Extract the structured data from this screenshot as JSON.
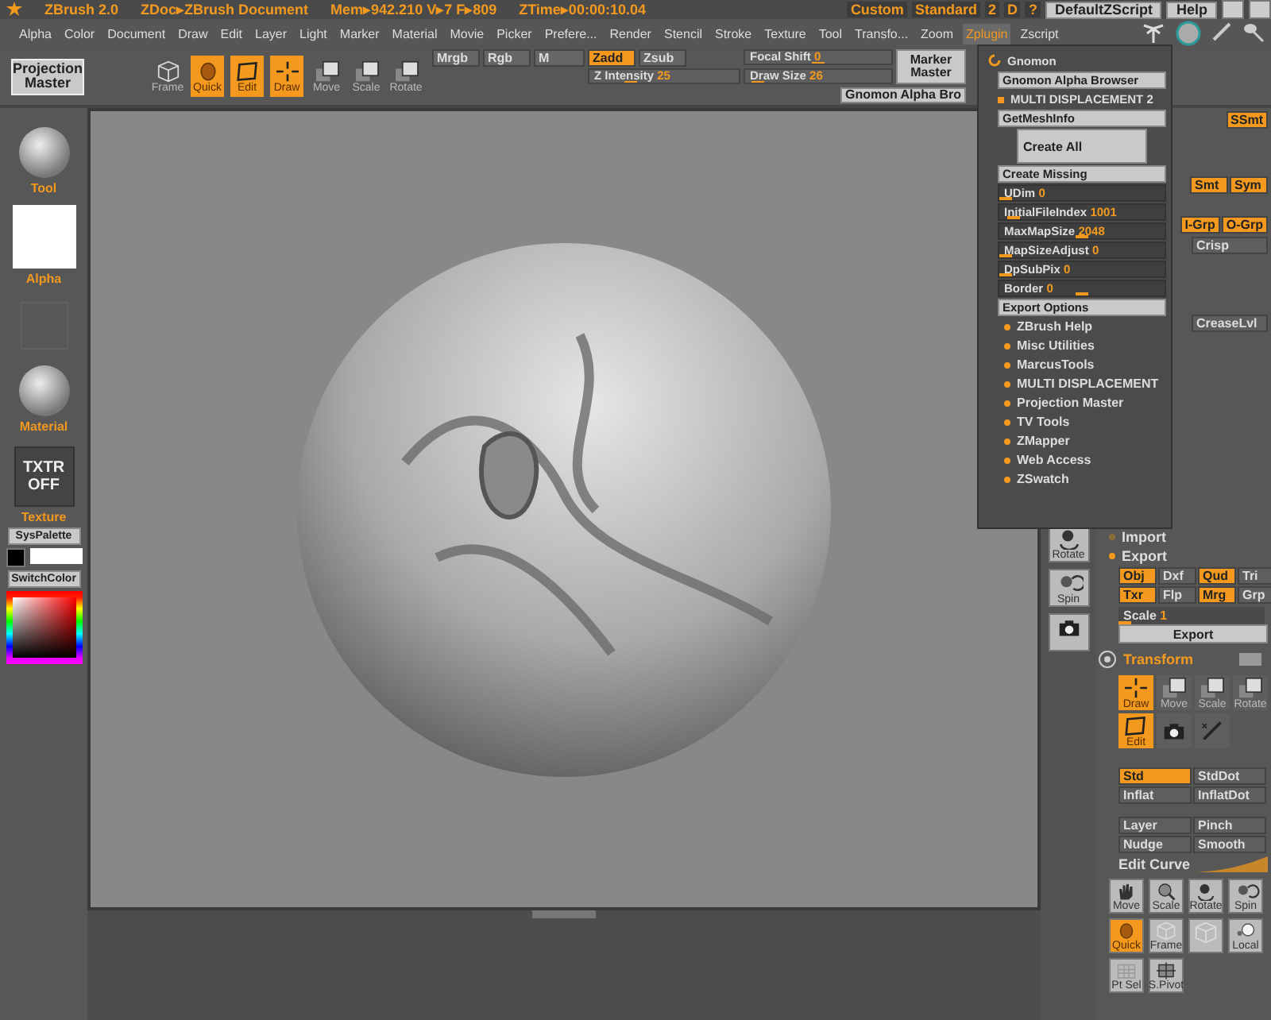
{
  "title_bar": {
    "app": "ZBrush 2.0",
    "doc": "ZDoc▸ZBrush Document",
    "stats": "Mem▸942.210 V▸7 F▸809",
    "time": "ZTime▸00:00:10.04",
    "layout": [
      "Custom",
      "Standard",
      "2",
      "D",
      "?"
    ],
    "buttons": [
      "DefaultZScript",
      "Help"
    ]
  },
  "menu": [
    {
      "label": "Alpha",
      "selected": false
    },
    {
      "label": "Color",
      "selected": false
    },
    {
      "label": "Document",
      "selected": false
    },
    {
      "label": "Draw",
      "selected": false
    },
    {
      "label": "Edit",
      "selected": false
    },
    {
      "label": "Layer",
      "selected": false
    },
    {
      "label": "Light",
      "selected": false
    },
    {
      "label": "Marker",
      "selected": false
    },
    {
      "label": "Material",
      "selected": false
    },
    {
      "label": "Movie",
      "selected": false
    },
    {
      "label": "Picker",
      "selected": false
    },
    {
      "label": "Prefere...",
      "selected": false
    },
    {
      "label": "Render",
      "selected": false
    },
    {
      "label": "Stencil",
      "selected": false
    },
    {
      "label": "Stroke",
      "selected": false
    },
    {
      "label": "Texture",
      "selected": false
    },
    {
      "label": "Tool",
      "selected": false
    },
    {
      "label": "Transfo...",
      "selected": false
    },
    {
      "label": "Zoom",
      "selected": false
    },
    {
      "label": "Zplugin",
      "selected": true
    },
    {
      "label": "Zscript",
      "selected": false
    }
  ],
  "toolbar": {
    "projection_master": "Projection Master",
    "tools": [
      {
        "label": "Frame",
        "kind": "cube",
        "on": false
      },
      {
        "label": "Quick",
        "kind": "quick",
        "on": true
      },
      {
        "label": "Edit",
        "kind": "edit",
        "on": true
      },
      {
        "label": "Draw",
        "kind": "draw",
        "on": true
      },
      {
        "label": "Move",
        "kind": "move",
        "on": false
      },
      {
        "label": "Scale",
        "kind": "scale",
        "on": false
      },
      {
        "label": "Rotate",
        "kind": "rotate",
        "on": false
      }
    ],
    "channels": [
      {
        "label": "Mrgb",
        "on": false
      },
      {
        "label": "Rgb",
        "on": false
      },
      {
        "label": "M",
        "on": false
      },
      {
        "label": "Zadd",
        "on": true
      },
      {
        "label": "Zsub",
        "on": false
      }
    ],
    "sliders": [
      {
        "label": "Focal Shift",
        "value": "0",
        "level": 0.5
      },
      {
        "label": "Z Intensity",
        "value": "25",
        "level": 0.25
      },
      {
        "label": "Draw Size",
        "value": "26",
        "level": 0.05
      }
    ],
    "marker_master": "Marker Master",
    "gnomon_button": "Gnomon Alpha Bro"
  },
  "left_panel": {
    "tool": "Tool",
    "alpha": "Alpha",
    "material": "Material",
    "texture_box": "TXTR OFF",
    "texture": "Texture",
    "palette": "SysPalette",
    "switch_color": "SwitchColor"
  },
  "plugin_menu": {
    "title": "Gnomon",
    "items": [
      {
        "kind": "button",
        "label": "Gnomon Alpha Browser"
      },
      {
        "kind": "header",
        "label": "MULTI DISPLACEMENT 2"
      },
      {
        "kind": "button",
        "label": "GetMeshInfo"
      },
      {
        "kind": "big",
        "label": "Create All"
      },
      {
        "kind": "button",
        "label": "Create Missing"
      },
      {
        "kind": "slider",
        "label": "UDim",
        "value": "0",
        "level": 0
      },
      {
        "kind": "slider",
        "label": "InitialFileIndex",
        "value": "1001",
        "level": 0.05
      },
      {
        "kind": "slider",
        "label": "MaxMapSize",
        "value": "2048",
        "level": 0.5
      },
      {
        "kind": "slider",
        "label": "MapSizeAdjust",
        "value": "0",
        "level": 0
      },
      {
        "kind": "slider",
        "label": "DpSubPix",
        "value": "0",
        "level": 0
      },
      {
        "kind": "slider",
        "label": "Border",
        "value": "0",
        "level": 0.5
      },
      {
        "kind": "button",
        "label": "Export Options"
      },
      {
        "kind": "section",
        "label": "ZBrush Help"
      },
      {
        "kind": "section",
        "label": "Misc Utilities"
      },
      {
        "kind": "section",
        "label": "MarcusTools"
      },
      {
        "kind": "section",
        "label": "MULTI DISPLACEMENT"
      },
      {
        "kind": "section",
        "label": "Projection Master"
      },
      {
        "kind": "section",
        "label": "TV Tools"
      },
      {
        "kind": "section",
        "label": "ZMapper"
      },
      {
        "kind": "section",
        "label": "Web Access"
      },
      {
        "kind": "section",
        "label": "ZSwatch"
      }
    ]
  },
  "shelf": [
    {
      "label": "Rotate",
      "kind": "rotate2"
    },
    {
      "label": "Spin",
      "kind": "spin"
    },
    {
      "kind": "camera"
    }
  ],
  "right_panel": {
    "top_rows": [
      [
        {
          "label": "SSmt",
          "on": true
        }
      ],
      [
        {
          "label": "Smt",
          "on": true
        },
        {
          "label": "Sym",
          "on": true
        }
      ],
      [
        {
          "label": "I-Grp",
          "on": true
        },
        {
          "label": "O-Grp",
          "on": true
        }
      ],
      [
        {
          "label": "Crisp",
          "on": false
        }
      ],
      [
        {
          "label": "CreaseLvl",
          "on": false
        }
      ]
    ],
    "sections": [
      {
        "label": "Import",
        "open": false
      },
      {
        "label": "Export",
        "open": true
      }
    ],
    "export_options": [
      {
        "label": "Obj",
        "on": true
      },
      {
        "label": "Dxf",
        "on": false
      },
      {
        "label": "Qud",
        "on": true
      },
      {
        "label": "Tri",
        "on": false
      },
      {
        "label": "Txr",
        "on": true
      },
      {
        "label": "Flp",
        "on": false
      },
      {
        "label": "Mrg",
        "on": true
      },
      {
        "label": "Grp",
        "on": false
      }
    ],
    "scale": {
      "label": "Scale",
      "value": "1",
      "level": 0
    },
    "export_button": "Export",
    "transform": "Transform",
    "transform_tools": [
      {
        "label": "Draw",
        "kind": "draw",
        "on": true
      },
      {
        "label": "Move",
        "kind": "move",
        "on": false
      },
      {
        "label": "Scale",
        "kind": "scale",
        "on": false
      },
      {
        "label": "Rotate",
        "kind": "rotate",
        "on": false
      },
      {
        "label": "Edit",
        "kind": "edit",
        "on": true
      },
      {
        "kind": "camera",
        "on": false
      },
      {
        "kind": "mstroke",
        "on": false
      }
    ],
    "strokes": [
      {
        "label": "Std",
        "on": true
      },
      {
        "label": "StdDot",
        "on": false
      },
      {
        "label": "Inflat",
        "on": false
      },
      {
        "label": "InflatDot",
        "on": false
      }
    ],
    "modes": [
      {
        "label": "Layer",
        "on": false
      },
      {
        "label": "Pinch",
        "on": false
      },
      {
        "label": "Nudge",
        "on": false
      },
      {
        "label": "Smooth",
        "on": false
      }
    ],
    "edit_curve": "Edit Curve",
    "view_tools": [
      {
        "label": "Move",
        "kind": "move2",
        "on": false
      },
      {
        "label": "Scale",
        "kind": "scale2",
        "on": false
      },
      {
        "label": "Rotate",
        "kind": "rotate2",
        "on": false
      },
      {
        "label": "Spin",
        "kind": "spin",
        "on": false
      },
      {
        "label": "Quick",
        "kind": "quick",
        "on": true
      },
      {
        "label": "Frame",
        "kind": "cube",
        "on": false
      },
      {
        "kind": "cube",
        "on": false
      },
      {
        "label": "Local",
        "kind": "local",
        "on": false
      },
      {
        "label": "Pt Sel",
        "kind": "ptsel",
        "on": false
      },
      {
        "label": "S.Pivot",
        "kind": "spivot",
        "on": false
      }
    ]
  }
}
